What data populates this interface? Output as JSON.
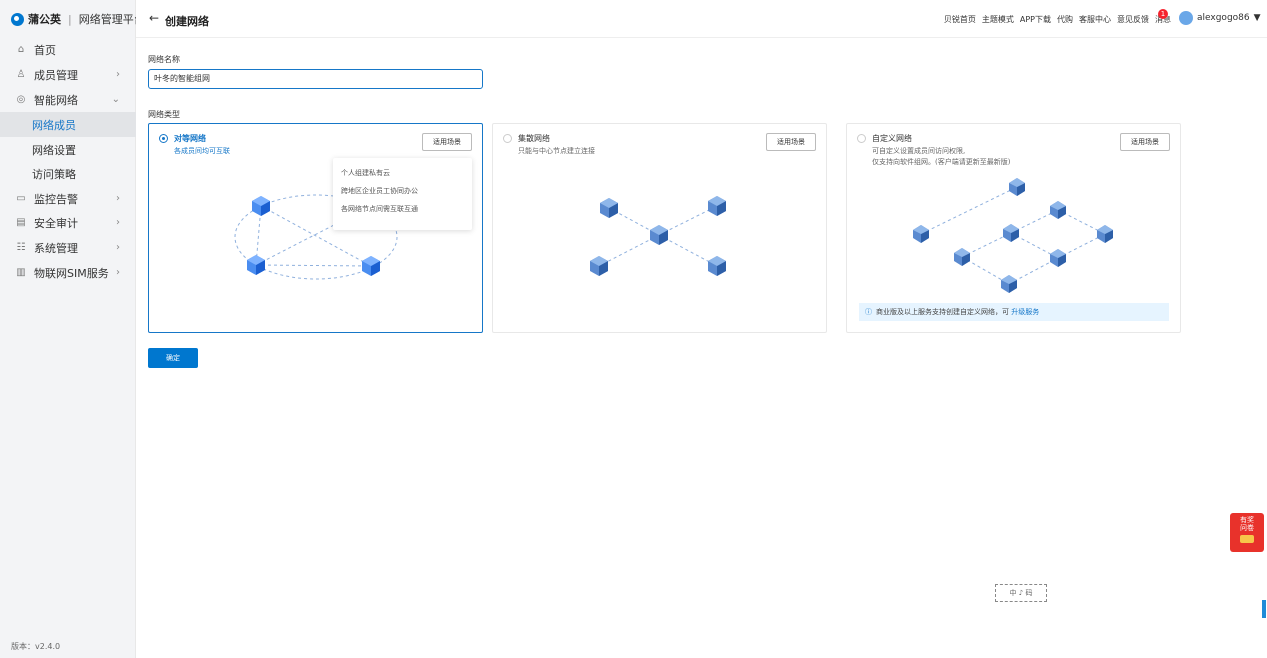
{
  "app": {
    "brand": "蒲公英",
    "subtitle": "网络管理平台",
    "version": "版本：v2.4.0"
  },
  "sidebar": {
    "items": [
      {
        "label": "首页",
        "icon": "home-icon",
        "glyph": "⌂"
      },
      {
        "label": "成员管理",
        "icon": "user-icon",
        "glyph": "♙",
        "chevron": "›"
      },
      {
        "label": "智能网络",
        "icon": "network-icon",
        "glyph": "◎",
        "chevron": "⌄"
      },
      {
        "label": "网络成员"
      },
      {
        "label": "网络设置"
      },
      {
        "label": "访问策略"
      },
      {
        "label": "监控告警",
        "icon": "monitor-icon",
        "glyph": "▭",
        "chevron": "›"
      },
      {
        "label": "安全审计",
        "icon": "audit-icon",
        "glyph": "▤",
        "chevron": "›"
      },
      {
        "label": "系统管理",
        "icon": "system-icon",
        "glyph": "☷",
        "chevron": "›"
      },
      {
        "label": "物联网SIM服务",
        "icon": "sim-icon",
        "glyph": "▥",
        "chevron": "›"
      }
    ]
  },
  "header": {
    "back": "←",
    "title": "创建网络",
    "links": [
      "贝锐首页",
      "主题模式",
      "APP下载",
      "代购",
      "客服中心",
      "意见反馈",
      "消息"
    ],
    "badge": "1",
    "user": "alexgogo86",
    "caret": "▼"
  },
  "form": {
    "name_label": "网络名称",
    "name_value": "叶冬的智能组网",
    "type_label": "网络类型",
    "confirm": "确定"
  },
  "cards": [
    {
      "title": "对等网络",
      "desc": [
        "各成员间均可互联"
      ],
      "button": "适用场景",
      "selected": true
    },
    {
      "title": "集散网络",
      "desc": [
        "只能与中心节点建立连接"
      ],
      "button": "适用场景",
      "selected": false
    },
    {
      "title": "自定义网络",
      "desc": [
        "可自定义设置成员间访问权限,",
        "仅支持向软件组网。(客户端请更新至最新版)"
      ],
      "button": "适用场景",
      "selected": false
    }
  ],
  "tooltip": {
    "items": [
      "个人组建私有云",
      "跨地区企业员工协同办公",
      "各网络节点间需互联互通"
    ]
  },
  "notice": {
    "icon": "ⓘ",
    "text": "商业版及以上服务支持创建自定义网络，可",
    "link": "升级服务"
  },
  "float": {
    "gift_line1": "有奖",
    "gift_line2": "问卷",
    "stamp": "中 ♪ 码"
  },
  "colors": {
    "accent": "#1677c8",
    "button": "#0077cf",
    "badge": "#f5222d",
    "cube": "#3d7ee6",
    "link_line": "#8fb0dd"
  }
}
